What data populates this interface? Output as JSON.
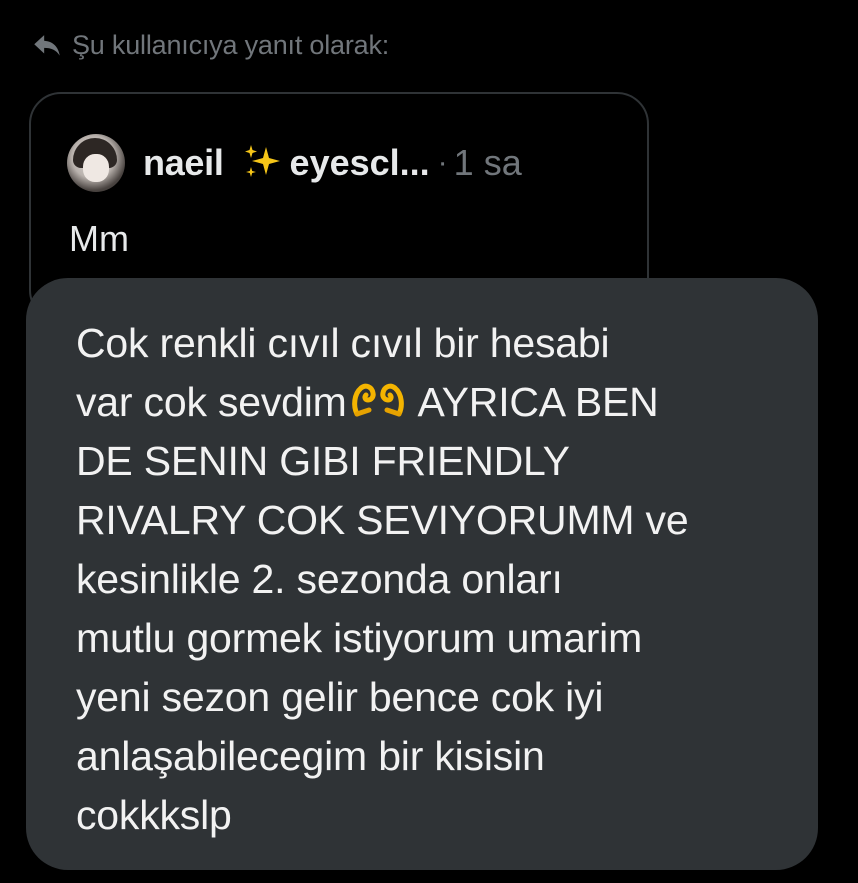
{
  "reply_header": {
    "icon": "reply-arrow-icon",
    "text": "Şu kullanıcıya yanıt olarak:"
  },
  "quoted_post": {
    "display_name": "naeil",
    "name_emoji": "sparkles-icon",
    "handle": "eyescl...",
    "separator": "·",
    "time": "1 sa",
    "text": "Mm"
  },
  "reply_message": {
    "part1": "Cok renkli cıvıl cıvıl bir hesabi\nvar cok sevdim",
    "emoji": "heart-hands-icon",
    "part2": " AYRICA BEN\nDE SENIN GIBI FRIENDLY\nRIVALRY COK SEVIYORUMM ve\nkesinlikle 2. sezonda onları\nmutlu gormek istiyorum umarim\nyeni sezon gelir bence cok iyi\nanlaşabilecegim bir kisisin\ncokkkslp"
  },
  "colors": {
    "background": "#000000",
    "bubble": "#2f3336",
    "muted": "#71767b",
    "text": "#e7e9ea"
  }
}
